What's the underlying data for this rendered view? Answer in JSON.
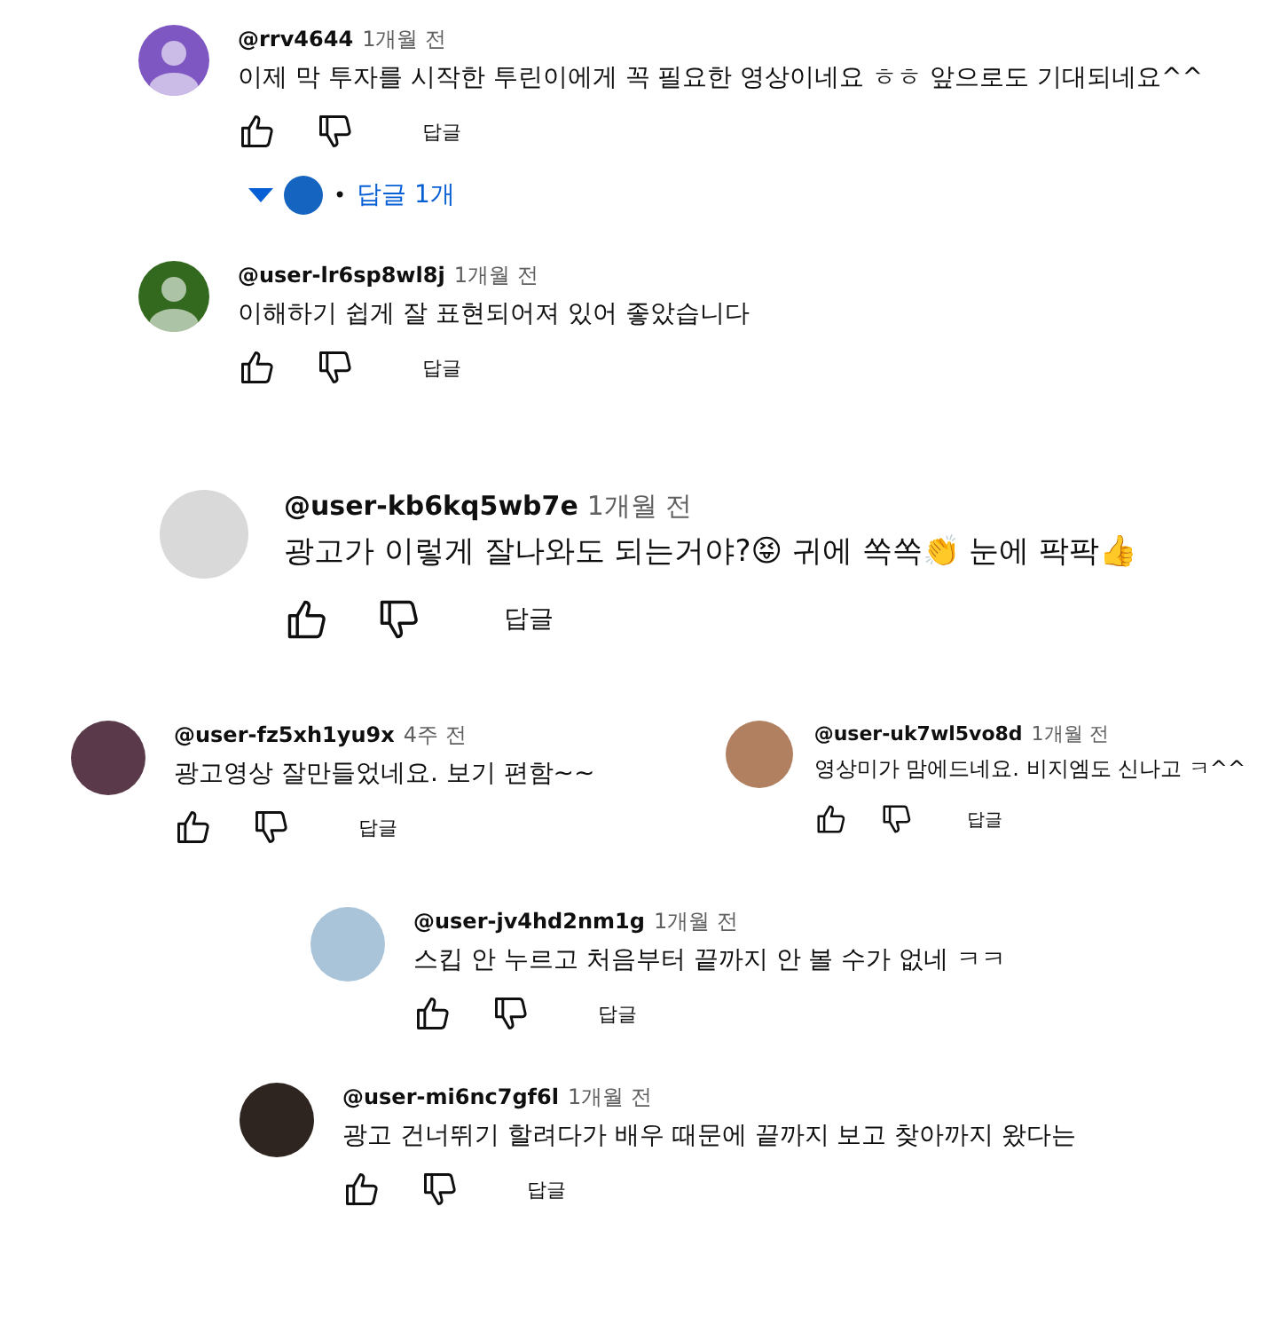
{
  "comments": [
    {
      "author": "@rrv4644",
      "time": "1개월 전",
      "text": "이제 막 투자를 시작한 투린이에게 꼭 필요한 영상이네요 ㅎㅎ 앞으로도 기대되네요^^",
      "reply_label": "답글",
      "avatar": {
        "kind": "default",
        "color": "#7e57c2"
      },
      "replies": {
        "bullet": "•",
        "label": "답글 1개"
      }
    },
    {
      "author": "@user-lr6sp8wl8j",
      "time": "1개월 전",
      "text": "이해하기 쉽게 잘 표현되어져 있어 좋았습니다",
      "reply_label": "답글",
      "avatar": {
        "kind": "default",
        "color": "#33691e"
      }
    },
    {
      "author": "@user-kb6kq5wb7e",
      "time": "1개월 전",
      "text": "광고가 이렇게 잘나와도 되는거야?😝 귀에 쏙쏙👏 눈에 팍팍👍",
      "reply_label": "답글",
      "avatar": {
        "kind": "photo",
        "color": "#d9d9d9"
      }
    },
    {
      "author": "@user-fz5xh1yu9x",
      "time": "4주 전",
      "text": "광고영상 잘만들었네요. 보기 편함~~",
      "reply_label": "답글",
      "avatar": {
        "kind": "photo",
        "color": "#5a3a4a"
      }
    },
    {
      "author": "@user-uk7wl5vo8d",
      "time": "1개월 전",
      "text": "영상미가 맘에드네요. 비지엠도 신나고 ㅋ^^",
      "reply_label": "답글",
      "avatar": {
        "kind": "photo",
        "color": "#b08060"
      }
    },
    {
      "author": "@user-jv4hd2nm1g",
      "time": "1개월 전",
      "text": "스킵 안 누르고 처음부터 끝까지 안 볼 수가 없네 ㅋㅋ",
      "reply_label": "답글",
      "avatar": {
        "kind": "photo",
        "color": "#a9c3d8"
      }
    },
    {
      "author": "@user-mi6nc7gf6l",
      "time": "1개월 전",
      "text": "광고 건너뛰기 할려다가 배우 때문에 끝까지 보고 찾아까지 왔다는",
      "reply_label": "답글",
      "avatar": {
        "kind": "photo",
        "color": "#2e2420"
      }
    }
  ]
}
